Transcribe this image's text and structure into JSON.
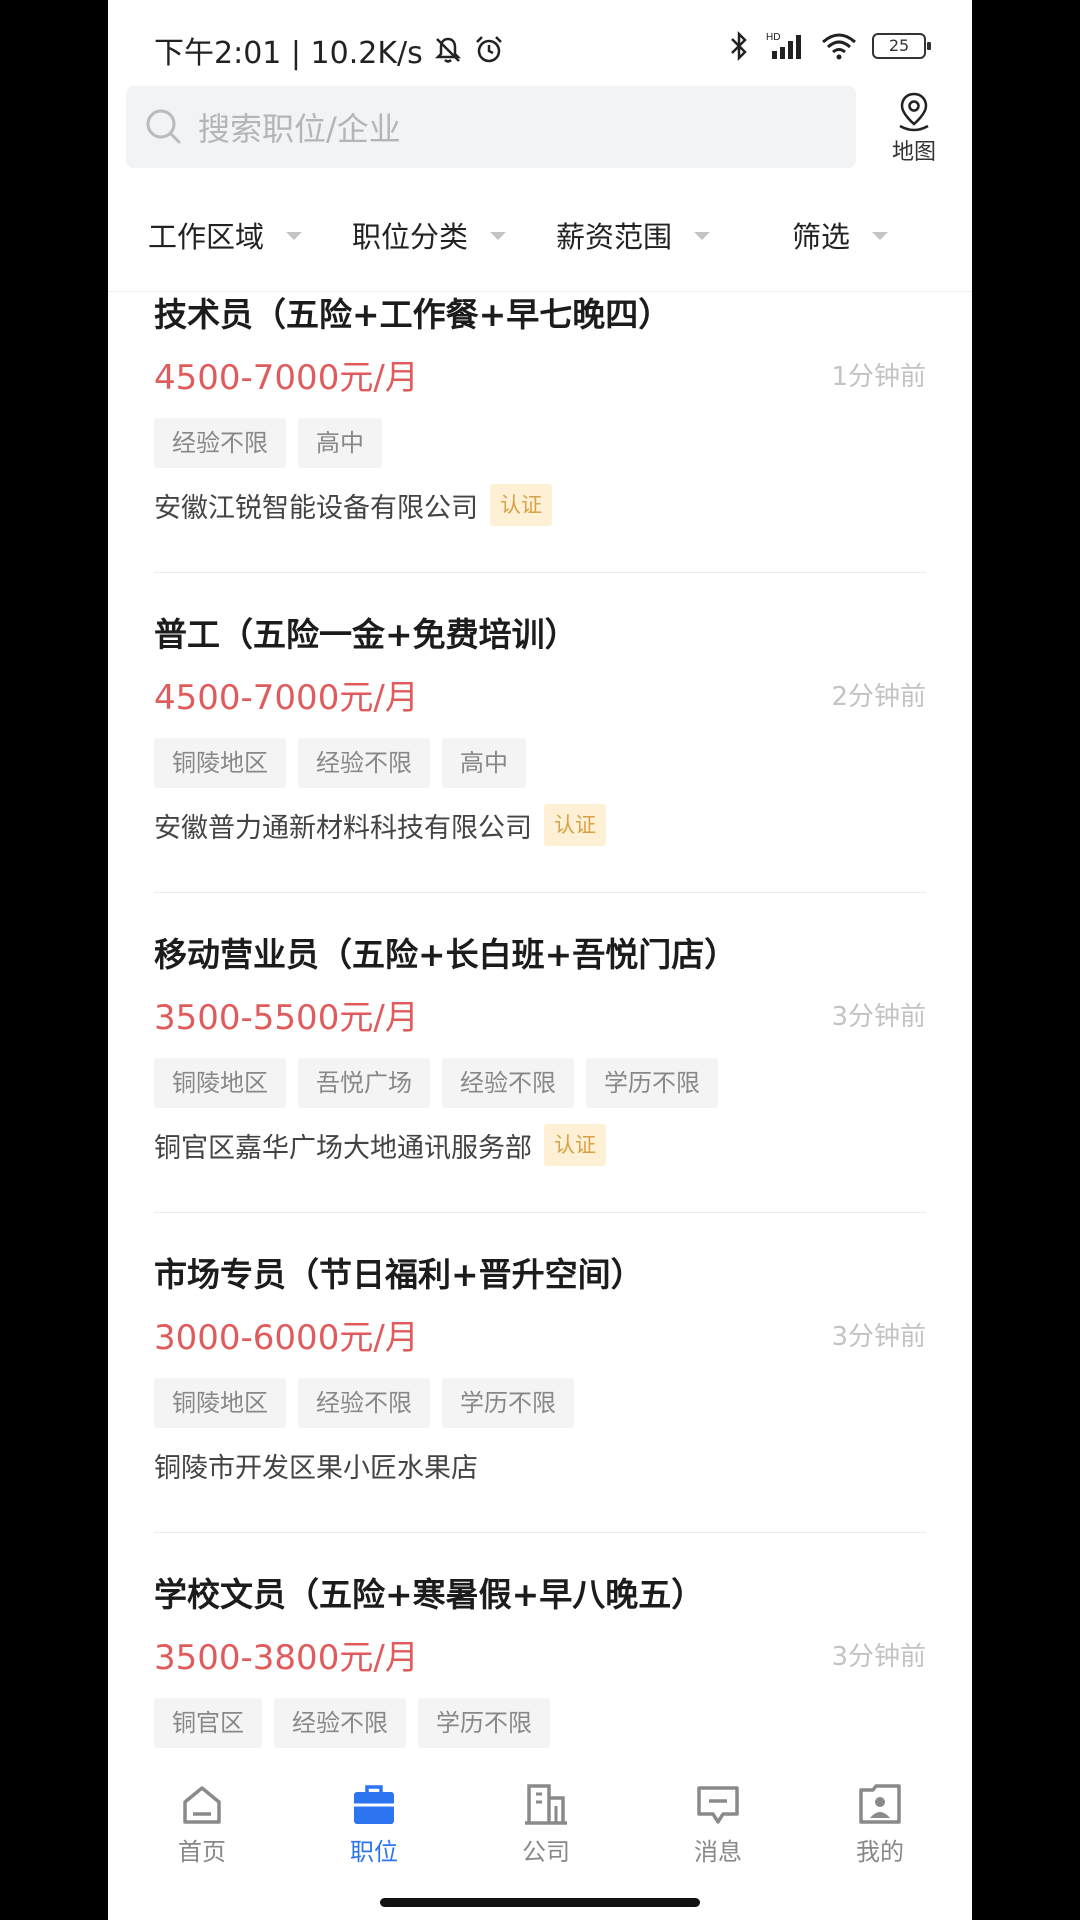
{
  "status_bar": {
    "time_speed": "下午2:01 | 10.2K/s",
    "battery": "25",
    "signal_label": "HD"
  },
  "search": {
    "placeholder": "搜索职位/企业"
  },
  "map": {
    "label": "地图"
  },
  "filters": [
    "工作区域",
    "职位分类",
    "薪资范围",
    "筛选"
  ],
  "jobs": [
    {
      "title": "技术员（五险+工作餐+早七晚四）",
      "salary": "4500-7000元/月",
      "time": "1分钟前",
      "tags": [
        "经验不限",
        "高中"
      ],
      "company": "安徽江锐智能设备有限公司",
      "verified": "认证"
    },
    {
      "title": "普工（五险一金+免费培训）",
      "salary": "4500-7000元/月",
      "time": "2分钟前",
      "tags": [
        "铜陵地区",
        "经验不限",
        "高中"
      ],
      "company": "安徽普力通新材料科技有限公司",
      "verified": "认证"
    },
    {
      "title": "移动营业员（五险+长白班+吾悦门店）",
      "salary": "3500-5500元/月",
      "time": "3分钟前",
      "tags": [
        "铜陵地区",
        "吾悦广场",
        "经验不限",
        "学历不限"
      ],
      "company": "铜官区嘉华广场大地通讯服务部",
      "verified": "认证"
    },
    {
      "title": "市场专员（节日福利+晋升空间）",
      "salary": "3000-6000元/月",
      "time": "3分钟前",
      "tags": [
        "铜陵地区",
        "经验不限",
        "学历不限"
      ],
      "company": "铜陵市开发区果小匠水果店",
      "verified": ""
    },
    {
      "title": "学校文员（五险+寒暑假+早八晚五）",
      "salary": "3500-3800元/月",
      "time": "3分钟前",
      "tags": [
        "铜官区",
        "经验不限",
        "学历不限"
      ],
      "company": "",
      "verified": ""
    }
  ],
  "nav": {
    "items": [
      "首页",
      "职位",
      "公司",
      "消息",
      "我的"
    ],
    "active": "职位"
  },
  "colors": {
    "salary": "#e05c5c",
    "accent": "#2d74f0",
    "verified_bg": "#fdf0d4",
    "verified_text": "#d8a24a"
  }
}
